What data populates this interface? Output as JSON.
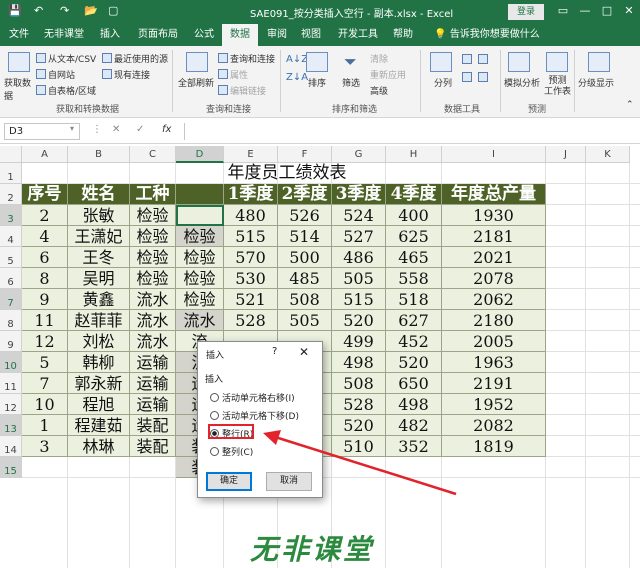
{
  "titlebar": {
    "save_icon": "💾",
    "undo_icon": "↶",
    "redo_icon": "↷",
    "open_icon": "📂",
    "quick_icon": "▢",
    "doc_title": "SAE091_按分类插入空行 - 副本.xlsx  -  Excel",
    "login": "登录",
    "ribbon_toggle": "▭",
    "minimize": "—",
    "maximize": "□",
    "close": "✕"
  },
  "tabs": [
    "文件",
    "无非课堂",
    "插入",
    "页面布局",
    "公式",
    "数据",
    "审阅",
    "视图",
    "开发工具",
    "帮助",
    "告诉我你想要做什么"
  ],
  "ribbon": {
    "get_data": "获取数据",
    "from_text": "从文本/CSV",
    "from_web": "自网站",
    "from_table": "自表格/区域",
    "recent_sources": "最近使用的源",
    "existing_conn": "现有连接",
    "group1": "获取和转换数据",
    "refresh_all": "全部刷新",
    "queries_conn": "查询和连接",
    "properties": "属性",
    "edit_links": "编辑链接",
    "group2": "查询和连接",
    "sort": "排序",
    "filter": "筛选",
    "clear": "清除",
    "reapply": "重新应用",
    "advanced": "高级",
    "group3": "排序和筛选",
    "text_to_col": "分列",
    "group4": "数据工具",
    "what_if": "模拟分析",
    "forecast": "预测\n工作表",
    "group5": "预测",
    "outline": "分级显示"
  },
  "formula_bar": {
    "name_box": "D3",
    "cancel": "✕",
    "confirm": "✓",
    "fx": "fx",
    "formula": ""
  },
  "columns": [
    "A",
    "B",
    "C",
    "D",
    "E",
    "F",
    "G",
    "H",
    "I",
    "J",
    "K"
  ],
  "rows": [
    "1",
    "2",
    "3",
    "4",
    "5",
    "6",
    "7",
    "8",
    "9",
    "10",
    "11",
    "12",
    "13",
    "14",
    "15"
  ],
  "sheet": {
    "title": "年度员工绩效表",
    "headers": [
      "序号",
      "姓名",
      "工种",
      "",
      "1季度",
      "2季度",
      "3季度",
      "4季度",
      "年度总产量"
    ],
    "data": [
      [
        "2",
        "张敏",
        "检验",
        "",
        "480",
        "526",
        "524",
        "400",
        "1930"
      ],
      [
        "4",
        "王潇妃",
        "检验",
        "检验",
        "515",
        "514",
        "527",
        "625",
        "2181"
      ],
      [
        "6",
        "王冬",
        "检验",
        "检验",
        "570",
        "500",
        "486",
        "465",
        "2021"
      ],
      [
        "8",
        "吴明",
        "检验",
        "检验",
        "530",
        "485",
        "505",
        "558",
        "2078"
      ],
      [
        "9",
        "黄鑫",
        "流水",
        "检验",
        "521",
        "508",
        "515",
        "518",
        "2062"
      ],
      [
        "11",
        "赵菲菲",
        "流水",
        "流水",
        "528",
        "505",
        "520",
        "627",
        "2180"
      ],
      [
        "12",
        "刘松",
        "流水",
        "流",
        "",
        "",
        "499",
        "452",
        "2005"
      ],
      [
        "5",
        "韩柳",
        "运输",
        "流",
        "",
        "",
        "498",
        "520",
        "1963"
      ],
      [
        "7",
        "郭永新",
        "运输",
        "运",
        "",
        "",
        "508",
        "650",
        "2191"
      ],
      [
        "10",
        "程旭",
        "运输",
        "运",
        "",
        "",
        "528",
        "498",
        "1952"
      ],
      [
        "1",
        "程建茹",
        "装配",
        "运",
        "",
        "",
        "520",
        "482",
        "2082"
      ],
      [
        "3",
        "林琳",
        "装配",
        "装",
        "",
        "",
        "510",
        "352",
        "1819"
      ],
      [
        "",
        "",
        "",
        "装",
        "",
        "",
        "",
        "",
        ""
      ]
    ]
  },
  "dialog": {
    "title": "插入",
    "help": "?",
    "close": "✕",
    "section": "插入",
    "options": [
      "活动单元格右移(I)",
      "活动单元格下移(D)",
      "整行(R)",
      "整列(C)"
    ],
    "selected_option": "整行(R)",
    "ok": "确定",
    "cancel": "取消"
  },
  "watermark": "无非课堂",
  "colors": {
    "accent": "#217346",
    "header_fill": "#4e6228",
    "body_fill": "#ebf1de",
    "highlight": "#e1242c"
  }
}
